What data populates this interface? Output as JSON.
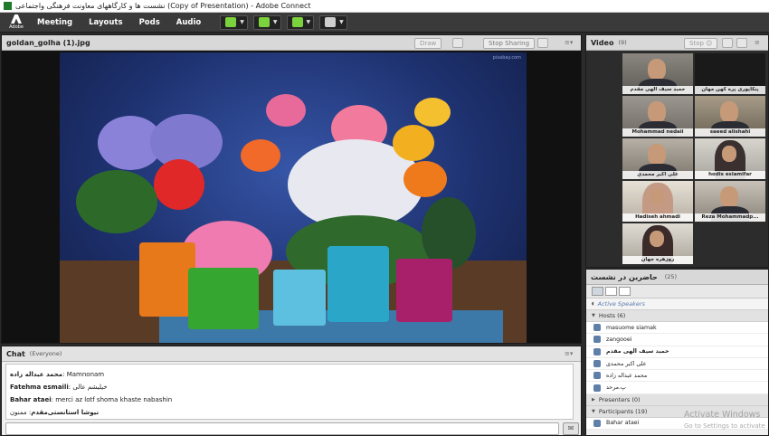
{
  "window": {
    "title": "نشست ها و کارگاههای معاونت فرهنگی واجتماعی (Copy of Presentation) - Adobe Connect"
  },
  "menubar": {
    "logo_text": "Adobe",
    "items": [
      "Meeting",
      "Layouts",
      "Pods",
      "Audio"
    ],
    "icons": [
      "speaker-icon",
      "microphone-icon",
      "webcam-icon",
      "raise-hand-icon"
    ]
  },
  "share": {
    "title": "goldan_golha (1).jpg",
    "draw_label": "Draw",
    "stop_label": "Stop Sharing",
    "image_watermark": "pixabay.com",
    "colors": {
      "wall": "#1e3270",
      "table": "#5a3b26",
      "cloth": "#3c79a8"
    }
  },
  "chat": {
    "title": "Chat",
    "audience": "(Everyone)",
    "messages": [
      {
        "sender": "محمد عبداله زاده",
        "text": "Mamnonam"
      },
      {
        "sender": "Fatehma esmaili",
        "text": "خیلیشم عالی"
      },
      {
        "sender": "Bahar ataei",
        "text": "merci  az  lotf shoma khaste nabashin"
      },
      {
        "sender": "نیوشا استانستی‌مقدم",
        "text": "ممنون"
      }
    ]
  },
  "video": {
    "title": "Video",
    "count": "(9)",
    "stop_label": "Stop",
    "participants": [
      "حمید سیف  الهی  مقدم",
      "پنکاپوری پره کهن مهان",
      "Mohammad nedaii",
      "saeed alishahi",
      "علی اکبر محمدی",
      "hodis eslamifar",
      "Hadiseh ahmadi",
      "Reza Mohammadp...",
      "روزهره جهان"
    ]
  },
  "attendees": {
    "title": "حاضرین در نشست",
    "count": "(25)",
    "active_speakers": "Active Speakers",
    "hosts_label": "Hosts",
    "hosts_count": "(6)",
    "hosts": [
      "masuome siamak",
      "zangooei",
      "حمید سیف  الهی  مقدم",
      "علی اکبر محمدی",
      "محمد عبداله زاده",
      "پ.مرحد"
    ],
    "presenters_label": "Presenters",
    "presenters_count": "(0)",
    "participants_label": "Participants",
    "participants_count": "(19)",
    "participants": [
      "Bahar ataei"
    ]
  },
  "os_watermark": {
    "line1": "Activate Windows",
    "line2": "Go to Settings to activate"
  }
}
